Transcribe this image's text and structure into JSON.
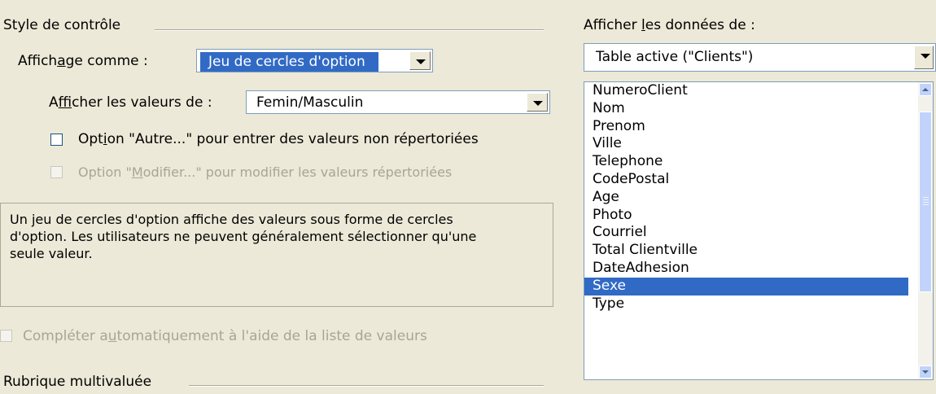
{
  "control_style": {
    "group_label": "Style de contrôle",
    "display_as": {
      "label_pre": "Affich",
      "label_u": "a",
      "label_post": "ge comme :",
      "value": "Jeu de cercles d'option"
    },
    "show_values_from": {
      "label_pre": "A",
      "label_u": "f",
      "label_post": "ficher les valeurs de :",
      "value": "Femin/Masculin"
    },
    "option_other": {
      "label_pre": "Opt",
      "label_u": "i",
      "label_post": "on \"Autre...\" pour entrer des valeurs non répertoriées",
      "checked": false
    },
    "option_modify": {
      "label_pre": "Option \"",
      "label_u": "M",
      "label_post": "odifier...\" pour modifier les valeurs répertoriées",
      "checked": false,
      "disabled": true
    },
    "description": "Un jeu de cercles d'option affiche des valeurs sous forme de cercles d'option. Les utilisateurs ne peuvent généralement sélectionner qu'une seule valeur.",
    "autocomplete": {
      "label_pre": "Compléter a",
      "label_u": "u",
      "label_post": "tomatiquement à l'aide de la liste de valeurs",
      "checked": false,
      "disabled": true
    },
    "multivalued_group_label": "Rubrique multivaluée"
  },
  "data_source": {
    "label_pre": "Afficher ",
    "label_u": "l",
    "label_post": "es données de :",
    "table_value": "Table active (\"Clients\")",
    "fields": [
      "NumeroClient",
      "Nom",
      "Prenom",
      "Ville",
      "Telephone",
      "CodePostal",
      "Age",
      "Photo",
      "Courriel",
      "Total Clientville",
      "DateAdhesion",
      "Sexe",
      "Type"
    ],
    "selected_field": "Sexe"
  },
  "colors": {
    "dialog_bg": "#ece9d8",
    "selection": "#316ac5",
    "disabled_text": "#a7a597"
  }
}
